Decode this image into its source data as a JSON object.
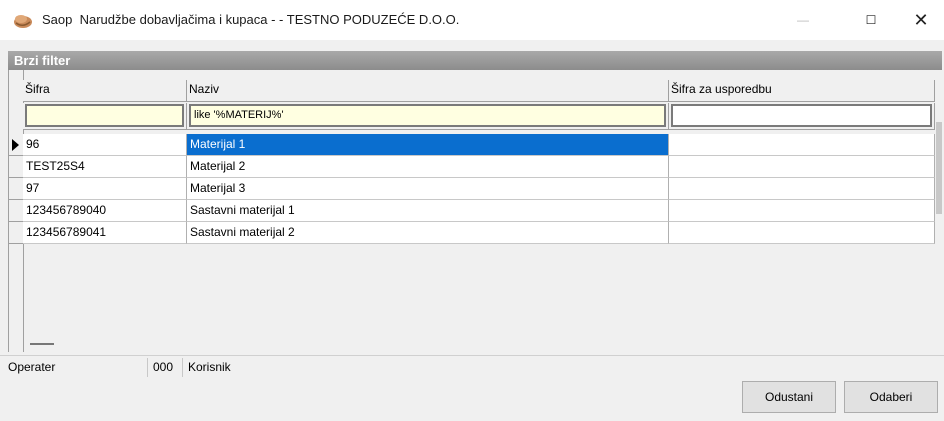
{
  "window": {
    "app_name": "Saop",
    "title": "Narudžbe dobavljačima i kupaca - - TESTNO PODUZEĆE D.O.O.",
    "minimize_symbol": "—",
    "maximize_symbol": "☐",
    "close_symbol": "✕"
  },
  "filter_panel": {
    "title": "Brzi filter"
  },
  "grid": {
    "columns": [
      {
        "label": "Šifra",
        "filter_value": ""
      },
      {
        "label": "Naziv",
        "filter_value": "like '%MATERIJ%'"
      },
      {
        "label": "Šifra za usporedbu",
        "filter_value": ""
      }
    ],
    "rows": [
      {
        "sifra": "96",
        "naziv": "Materijal 1",
        "usporedba": "",
        "selected": true
      },
      {
        "sifra": "TEST25S4",
        "naziv": "Materijal 2",
        "usporedba": "",
        "selected": false
      },
      {
        "sifra": "97",
        "naziv": "Materijal 3",
        "usporedba": "",
        "selected": false
      },
      {
        "sifra": "123456789040",
        "naziv": "Sastavni materijal 1",
        "usporedba": "",
        "selected": false
      },
      {
        "sifra": "123456789041",
        "naziv": "Sastavni materijal 2",
        "usporedba": "",
        "selected": false
      }
    ]
  },
  "status_bar": {
    "operater": "Operater",
    "code": "000",
    "korisnik": "Korisnik"
  },
  "buttons": {
    "cancel": "Odustani",
    "select": "Odaberi"
  },
  "colors": {
    "selection": "#0a6ecf",
    "filter_bg": "#ffffe1",
    "header_bar": "#999999"
  }
}
